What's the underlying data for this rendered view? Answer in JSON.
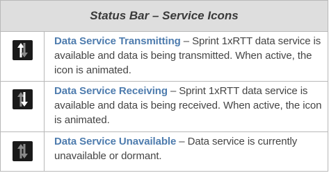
{
  "table": {
    "title": "Status Bar – Service Icons",
    "rows": [
      {
        "icon": "data-service-transmitting-icon",
        "title": "Data Service Transmitting",
        "separator": " – ",
        "description": "Sprint 1xRTT data service is available and data is being transmitted. When active, the icon is animated."
      },
      {
        "icon": "data-service-receiving-icon",
        "title": "Data Service Receiving",
        "separator": " – ",
        "description": "Sprint 1xRTT data service is available and data is being received. When active, the icon is animated."
      },
      {
        "icon": "data-service-unavailable-icon",
        "title": "Data Service Unavailable",
        "separator": " – ",
        "description": "Data service is currently unavailable or dormant."
      }
    ],
    "colors": {
      "header_bg": "#dedede",
      "title_link": "#4e7cae",
      "icon_bg": "#1a1a1a",
      "border": "#b8b8b8"
    }
  }
}
